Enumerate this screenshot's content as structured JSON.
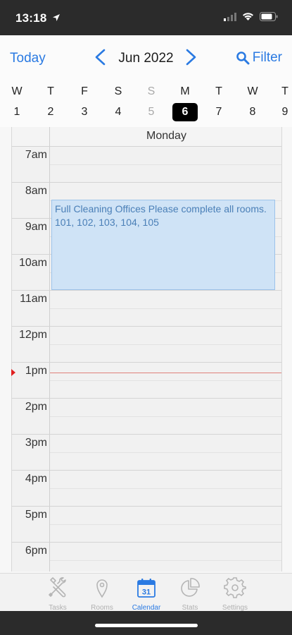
{
  "status_bar": {
    "time": "13:18"
  },
  "nav": {
    "today_label": "Today",
    "month_label": "Jun 2022",
    "filter_label": "Filter",
    "accent_color": "#2a7ae2"
  },
  "week": {
    "days": [
      {
        "letter": "W",
        "num": "1"
      },
      {
        "letter": "T",
        "num": "2"
      },
      {
        "letter": "F",
        "num": "3"
      },
      {
        "letter": "S",
        "num": "4"
      },
      {
        "letter": "S",
        "num": "5"
      },
      {
        "letter": "M",
        "num": "6"
      },
      {
        "letter": "T",
        "num": "7"
      },
      {
        "letter": "W",
        "num": "8"
      },
      {
        "letter": "T",
        "num": "9"
      }
    ],
    "selected_num": "6"
  },
  "calendar": {
    "column_title": "Monday",
    "hours": [
      "7am",
      "8am",
      "9am",
      "10am",
      "11am",
      "12pm",
      "1pm",
      "2pm",
      "3pm",
      "4pm",
      "5pm",
      "6pm"
    ],
    "event": {
      "title": "Full Cleaning Offices Please complete all rooms.",
      "rooms": "101, 102, 103, 104, 105"
    }
  },
  "tabbar": {
    "tabs": [
      {
        "label": "Tasks",
        "icon": "tools-icon"
      },
      {
        "label": "Rooms",
        "icon": "map-pin-icon"
      },
      {
        "label": "Calendar",
        "icon": "calendar-icon",
        "badge": "31"
      },
      {
        "label": "Stats",
        "icon": "pie-chart-icon"
      },
      {
        "label": "Settings",
        "icon": "gear-icon"
      }
    ],
    "active": "Calendar"
  }
}
